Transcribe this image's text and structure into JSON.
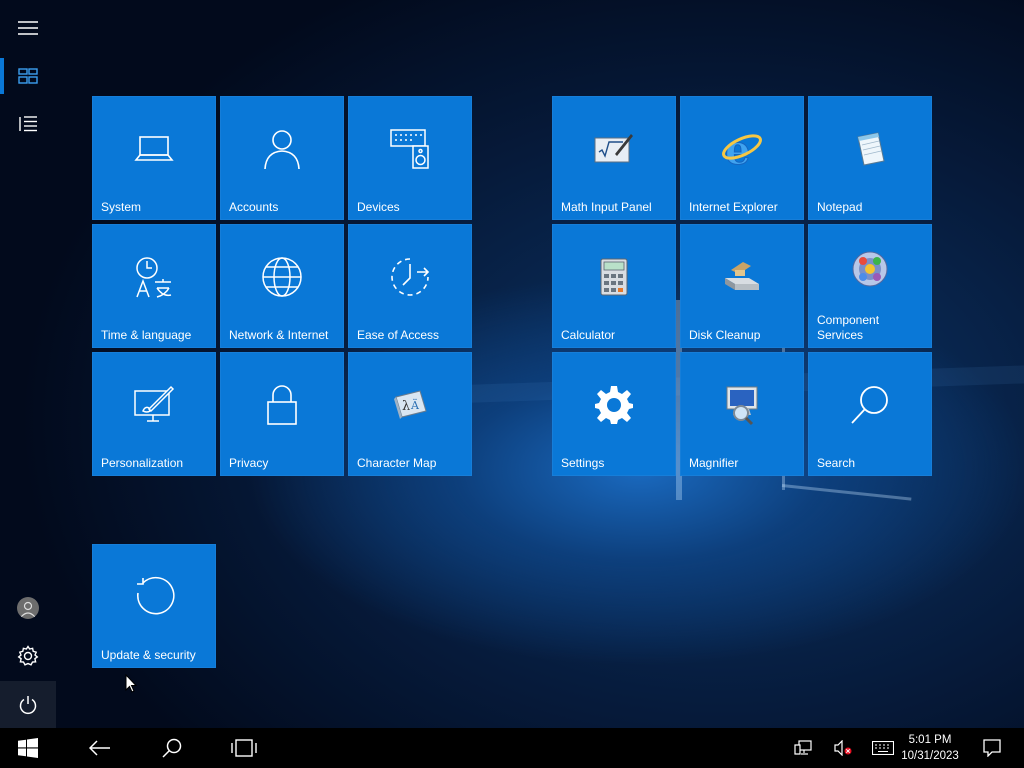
{
  "tiles": {
    "system": "System",
    "accounts": "Accounts",
    "devices": "Devices",
    "time_language": "Time & language",
    "network": "Network & Internet",
    "ease_of_access": "Ease of Access",
    "personalization": "Personalization",
    "privacy": "Privacy",
    "character_map": "Character Map",
    "update_security": "Update & security",
    "math_input": "Math Input Panel",
    "internet_explorer": "Internet Explorer",
    "notepad": "Notepad",
    "calculator": "Calculator",
    "disk_cleanup": "Disk Cleanup",
    "component_services": "Component Services",
    "settings": "Settings",
    "magnifier": "Magnifier",
    "search": "Search"
  },
  "rail": {
    "icons": [
      "hamburger-icon",
      "tiles-icon",
      "list-icon",
      "user-avatar-icon",
      "gear-icon",
      "power-icon"
    ]
  },
  "taskbar": {
    "time": "5:01 PM",
    "date": "10/31/2023",
    "icons": [
      "windows-logo-icon",
      "back-arrow-icon",
      "search-icon",
      "task-view-icon",
      "network-icon",
      "volume-muted-icon",
      "keyboard-icon",
      "action-center-icon"
    ]
  },
  "colors": {
    "tile": "#0a78d7",
    "taskbar": "#000000",
    "accent": "#0a78d7"
  }
}
